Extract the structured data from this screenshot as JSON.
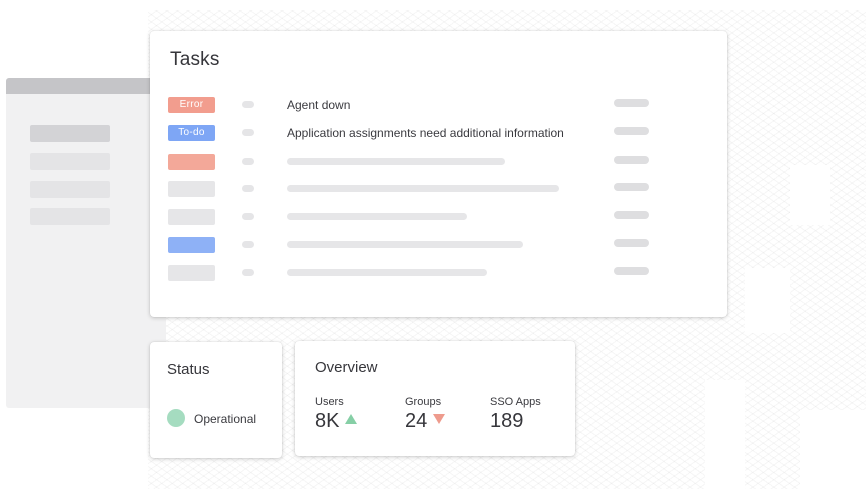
{
  "colors": {
    "error": "#f29d8e",
    "todo": "#7ea6f5",
    "neutral": "#e5e5e7",
    "operational": "#a5dcc0",
    "trend_up": "#86cfa6",
    "trend_down": "#ee9b8d"
  },
  "tasks": {
    "title": "Tasks",
    "rows": [
      {
        "badge": "Error",
        "badge_color": "#f29d8e",
        "text": "Agent down"
      },
      {
        "badge": "To-do",
        "badge_color": "#7ea6f5",
        "text": "Application assignments need additional information"
      },
      {
        "badge": "",
        "badge_color": "#f3a899",
        "text": ""
      },
      {
        "badge": "",
        "badge_color": "#e6e6e8",
        "text": ""
      },
      {
        "badge": "",
        "badge_color": "#e6e6e8",
        "text": ""
      },
      {
        "badge": "",
        "badge_color": "#8eb1f6",
        "text": ""
      },
      {
        "badge": "",
        "badge_color": "#e6e6e8",
        "text": ""
      }
    ]
  },
  "status": {
    "title": "Status",
    "state": "Operational"
  },
  "overview": {
    "title": "Overview",
    "metrics": [
      {
        "label": "Users",
        "value": "8K",
        "trend": "up-triangle-icon"
      },
      {
        "label": "Groups",
        "value": "24",
        "trend": "down-triangle-icon"
      },
      {
        "label": "SSO Apps",
        "value": "189",
        "trend": ""
      }
    ]
  }
}
